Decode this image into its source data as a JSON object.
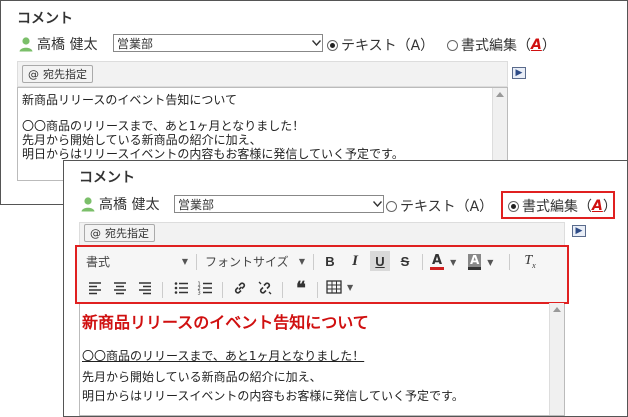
{
  "panel_a": {
    "title": "コメント",
    "user_name": "高橋 健太",
    "department": "営業部",
    "mode_text_label": "テキスト（A）",
    "mode_rich_label": "書式編集（",
    "mode_rich_a": "A",
    "mode_rich_close": "）",
    "mode_selected": "text",
    "address_button": "宛先指定",
    "body_lines": [
      "新商品リリースのイベント告知について",
      "",
      "〇〇商品のリリースまで、あと1ヶ月となりました！",
      "先月から開始している新商品の紹介に加え、",
      "明日からはリリースイベントの内容もお客様に発信していく予定です。"
    ]
  },
  "panel_b": {
    "title": "コメント",
    "user_name": "高橋 健太",
    "department": "営業部",
    "mode_text_label": "テキスト（A）",
    "mode_rich_label": "書式編集（",
    "mode_rich_a": "A",
    "mode_rich_close": "）",
    "mode_selected": "rich",
    "address_button": "宛先指定",
    "toolbar": {
      "format_label": "書式",
      "font_size_label": "フォントサイズ"
    },
    "heading": "新商品リリースのイベント告知について",
    "underlined_line": "〇〇商品のリリースまで、あと1ヶ月となりました！",
    "line2": "先月から開始している新商品の紹介に加え、",
    "line3": "明日からはリリースイベントの内容もお客様に発信していく予定です。"
  },
  "colors": {
    "highlight_red": "#e02020",
    "heading_red": "#d01010",
    "user_icon_green": "#7bbf6a"
  },
  "icons": [
    "user-icon",
    "chevron-down-icon",
    "at-icon",
    "expand-icon",
    "bold-icon",
    "italic-icon",
    "underline-icon",
    "strikethrough-icon",
    "font-color-icon",
    "background-color-icon",
    "clear-format-icon",
    "align-left-icon",
    "align-center-icon",
    "align-right-icon",
    "bulleted-list-icon",
    "numbered-list-icon",
    "link-icon",
    "unlink-icon",
    "quote-icon",
    "table-icon"
  ]
}
